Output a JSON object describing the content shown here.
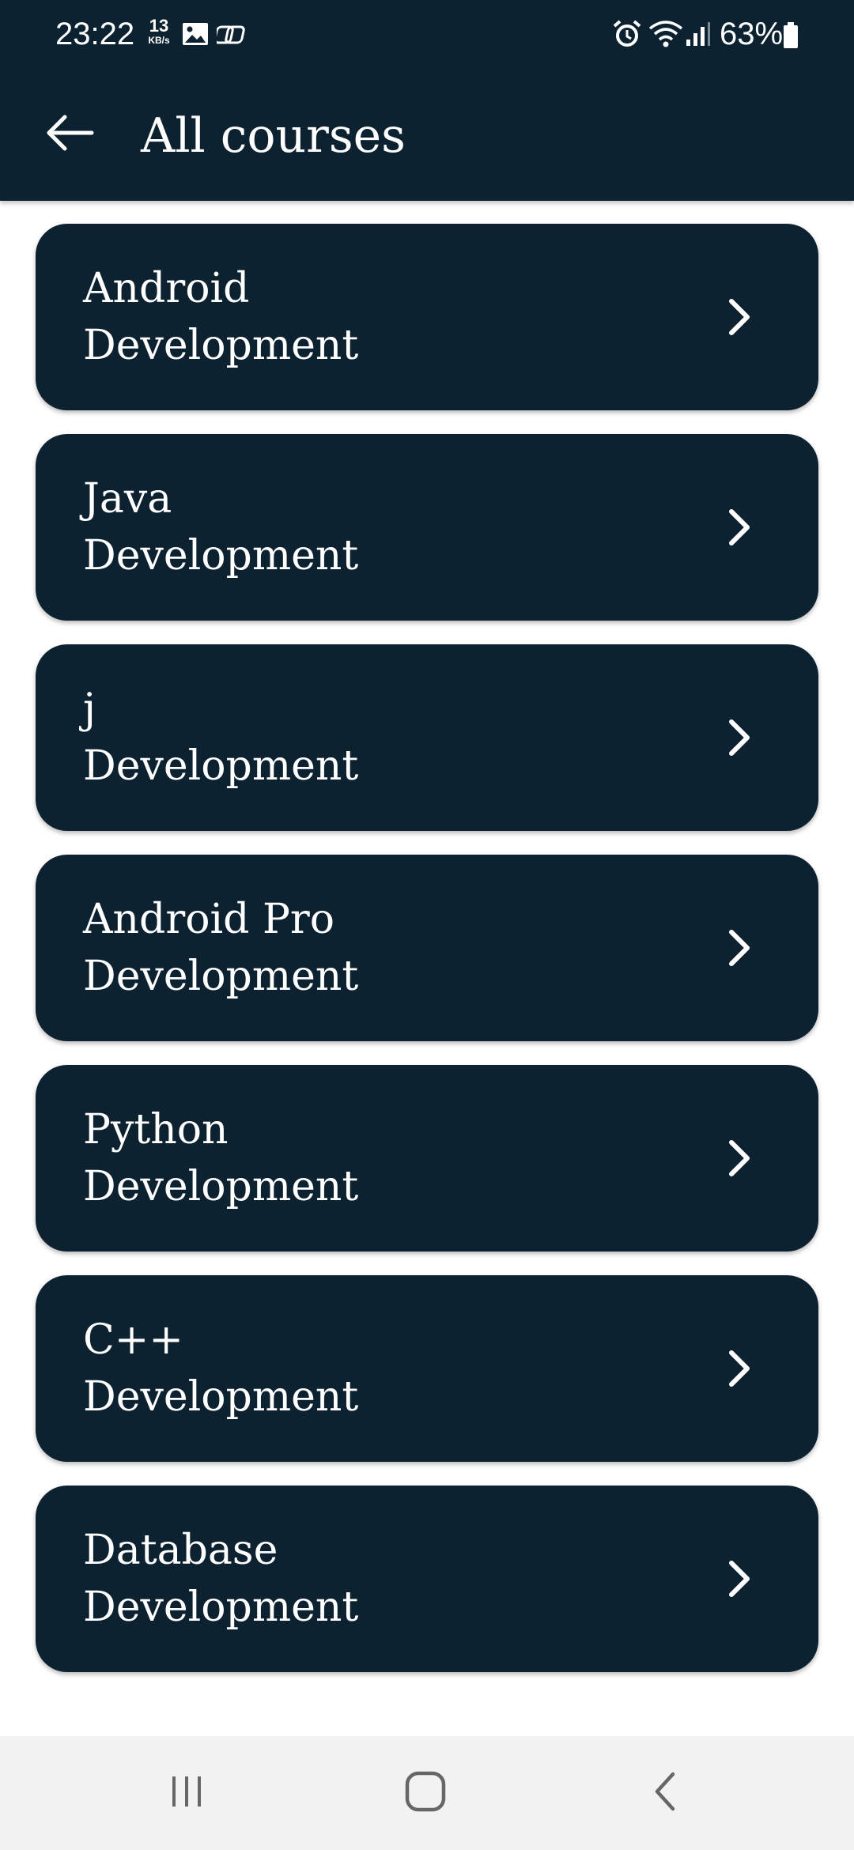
{
  "status_bar": {
    "time": "23:22",
    "network_speed_value": "13",
    "network_speed_unit": "KB/s",
    "battery_percent": "63%",
    "icons": [
      "image-icon",
      "link-icon",
      "alarm-icon",
      "wifi-icon",
      "signal-icon",
      "battery-icon"
    ]
  },
  "app_bar": {
    "back_icon": "arrow-left-icon",
    "title": "All courses"
  },
  "courses": [
    {
      "line1": "Android",
      "line2": "Development"
    },
    {
      "line1": "Java",
      "line2": "Development"
    },
    {
      "line1": "j",
      "line2": "Development"
    },
    {
      "line1": "Android Pro",
      "line2": "Development"
    },
    {
      "line1": "Python",
      "line2": "Development"
    },
    {
      "line1": "C++",
      "line2": "Development"
    },
    {
      "line1": "Database",
      "line2": "Development"
    }
  ],
  "nav_bar": {
    "buttons": [
      "recent-apps-icon",
      "home-icon",
      "back-icon"
    ]
  },
  "colors": {
    "primary": "#0d2230",
    "on_primary": "#ffffff",
    "background": "#ffffff",
    "nav_background": "#f2f2f2"
  }
}
